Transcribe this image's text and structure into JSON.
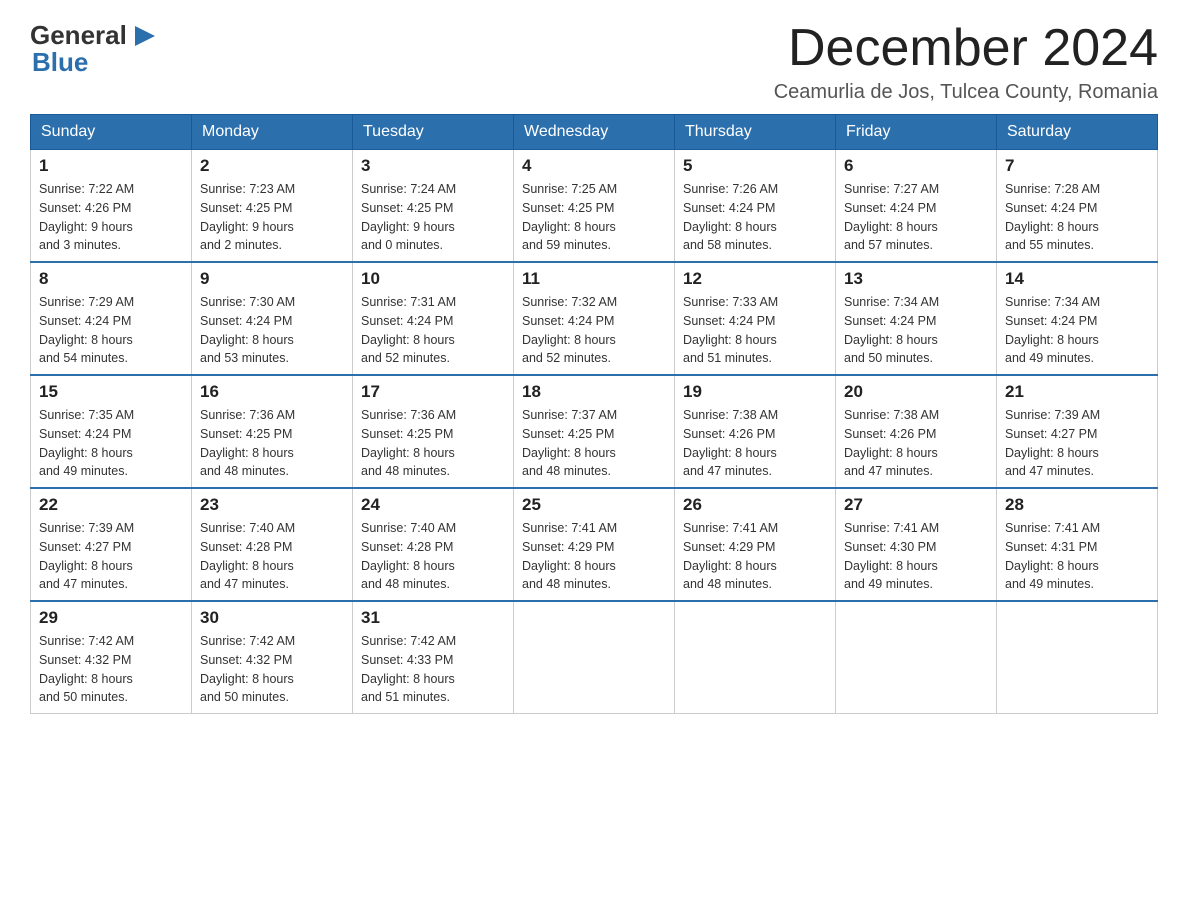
{
  "header": {
    "logo_line1": "General",
    "logo_line2": "Blue",
    "month_title": "December 2024",
    "location": "Ceamurlia de Jos, Tulcea County, Romania"
  },
  "days_of_week": [
    "Sunday",
    "Monday",
    "Tuesday",
    "Wednesday",
    "Thursday",
    "Friday",
    "Saturday"
  ],
  "weeks": [
    [
      {
        "day": "1",
        "sunrise": "7:22 AM",
        "sunset": "4:26 PM",
        "daylight": "9 hours and 3 minutes."
      },
      {
        "day": "2",
        "sunrise": "7:23 AM",
        "sunset": "4:25 PM",
        "daylight": "9 hours and 2 minutes."
      },
      {
        "day": "3",
        "sunrise": "7:24 AM",
        "sunset": "4:25 PM",
        "daylight": "9 hours and 0 minutes."
      },
      {
        "day": "4",
        "sunrise": "7:25 AM",
        "sunset": "4:25 PM",
        "daylight": "8 hours and 59 minutes."
      },
      {
        "day": "5",
        "sunrise": "7:26 AM",
        "sunset": "4:24 PM",
        "daylight": "8 hours and 58 minutes."
      },
      {
        "day": "6",
        "sunrise": "7:27 AM",
        "sunset": "4:24 PM",
        "daylight": "8 hours and 57 minutes."
      },
      {
        "day": "7",
        "sunrise": "7:28 AM",
        "sunset": "4:24 PM",
        "daylight": "8 hours and 55 minutes."
      }
    ],
    [
      {
        "day": "8",
        "sunrise": "7:29 AM",
        "sunset": "4:24 PM",
        "daylight": "8 hours and 54 minutes."
      },
      {
        "day": "9",
        "sunrise": "7:30 AM",
        "sunset": "4:24 PM",
        "daylight": "8 hours and 53 minutes."
      },
      {
        "day": "10",
        "sunrise": "7:31 AM",
        "sunset": "4:24 PM",
        "daylight": "8 hours and 52 minutes."
      },
      {
        "day": "11",
        "sunrise": "7:32 AM",
        "sunset": "4:24 PM",
        "daylight": "8 hours and 52 minutes."
      },
      {
        "day": "12",
        "sunrise": "7:33 AM",
        "sunset": "4:24 PM",
        "daylight": "8 hours and 51 minutes."
      },
      {
        "day": "13",
        "sunrise": "7:34 AM",
        "sunset": "4:24 PM",
        "daylight": "8 hours and 50 minutes."
      },
      {
        "day": "14",
        "sunrise": "7:34 AM",
        "sunset": "4:24 PM",
        "daylight": "8 hours and 49 minutes."
      }
    ],
    [
      {
        "day": "15",
        "sunrise": "7:35 AM",
        "sunset": "4:24 PM",
        "daylight": "8 hours and 49 minutes."
      },
      {
        "day": "16",
        "sunrise": "7:36 AM",
        "sunset": "4:25 PM",
        "daylight": "8 hours and 48 minutes."
      },
      {
        "day": "17",
        "sunrise": "7:36 AM",
        "sunset": "4:25 PM",
        "daylight": "8 hours and 48 minutes."
      },
      {
        "day": "18",
        "sunrise": "7:37 AM",
        "sunset": "4:25 PM",
        "daylight": "8 hours and 48 minutes."
      },
      {
        "day": "19",
        "sunrise": "7:38 AM",
        "sunset": "4:26 PM",
        "daylight": "8 hours and 47 minutes."
      },
      {
        "day": "20",
        "sunrise": "7:38 AM",
        "sunset": "4:26 PM",
        "daylight": "8 hours and 47 minutes."
      },
      {
        "day": "21",
        "sunrise": "7:39 AM",
        "sunset": "4:27 PM",
        "daylight": "8 hours and 47 minutes."
      }
    ],
    [
      {
        "day": "22",
        "sunrise": "7:39 AM",
        "sunset": "4:27 PM",
        "daylight": "8 hours and 47 minutes."
      },
      {
        "day": "23",
        "sunrise": "7:40 AM",
        "sunset": "4:28 PM",
        "daylight": "8 hours and 47 minutes."
      },
      {
        "day": "24",
        "sunrise": "7:40 AM",
        "sunset": "4:28 PM",
        "daylight": "8 hours and 48 minutes."
      },
      {
        "day": "25",
        "sunrise": "7:41 AM",
        "sunset": "4:29 PM",
        "daylight": "8 hours and 48 minutes."
      },
      {
        "day": "26",
        "sunrise": "7:41 AM",
        "sunset": "4:29 PM",
        "daylight": "8 hours and 48 minutes."
      },
      {
        "day": "27",
        "sunrise": "7:41 AM",
        "sunset": "4:30 PM",
        "daylight": "8 hours and 49 minutes."
      },
      {
        "day": "28",
        "sunrise": "7:41 AM",
        "sunset": "4:31 PM",
        "daylight": "8 hours and 49 minutes."
      }
    ],
    [
      {
        "day": "29",
        "sunrise": "7:42 AM",
        "sunset": "4:32 PM",
        "daylight": "8 hours and 50 minutes."
      },
      {
        "day": "30",
        "sunrise": "7:42 AM",
        "sunset": "4:32 PM",
        "daylight": "8 hours and 50 minutes."
      },
      {
        "day": "31",
        "sunrise": "7:42 AM",
        "sunset": "4:33 PM",
        "daylight": "8 hours and 51 minutes."
      },
      null,
      null,
      null,
      null
    ]
  ],
  "labels": {
    "sunrise": "Sunrise:",
    "sunset": "Sunset:",
    "daylight": "Daylight:"
  }
}
